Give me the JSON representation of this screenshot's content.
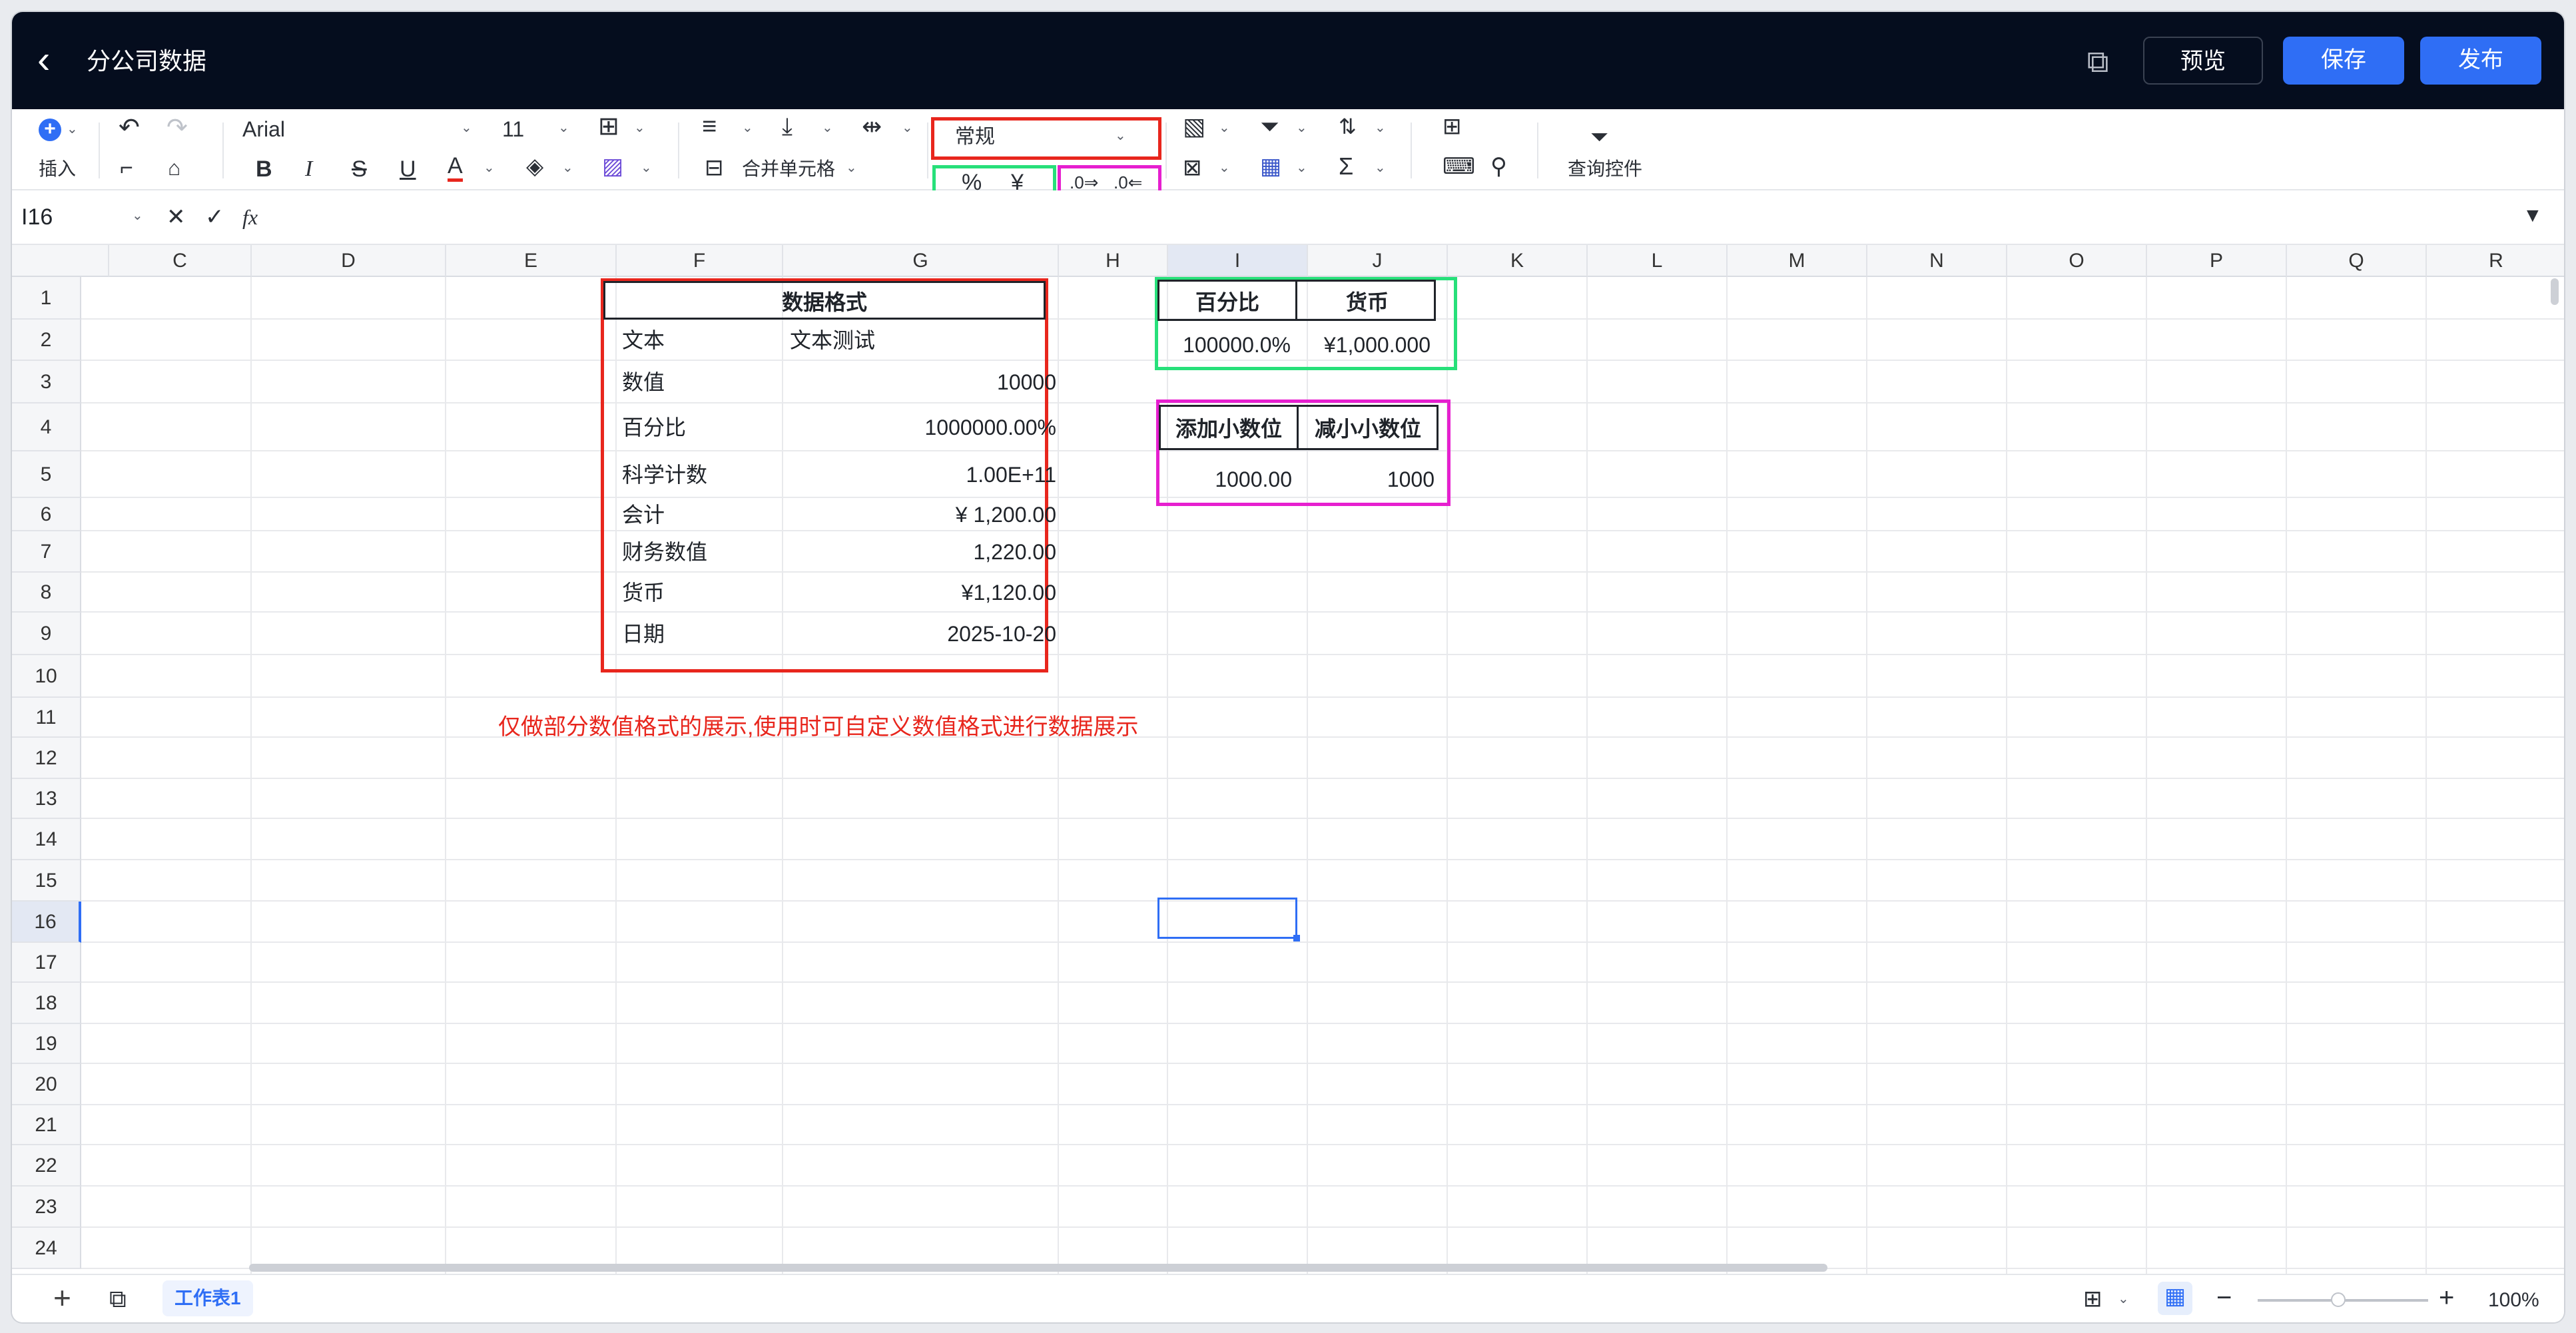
{
  "header": {
    "title": "分公司数据",
    "preview": "预览",
    "save": "保存",
    "publish": "发布"
  },
  "toolbar": {
    "insert": "插入",
    "font": "Arial",
    "font_size": "11",
    "merge": "合并单元格",
    "number_format": "常规",
    "query": "查询控件"
  },
  "formula_bar": {
    "cell_ref": "I16",
    "fx": "fx"
  },
  "columns": [
    "C",
    "D",
    "E",
    "F",
    "G",
    "H",
    "I",
    "J",
    "K",
    "L",
    "M",
    "N",
    "O",
    "P",
    "Q",
    "R"
  ],
  "rows": [
    "1",
    "2",
    "3",
    "4",
    "5",
    "6",
    "7",
    "8",
    "9",
    "10",
    "11",
    "12",
    "13",
    "14",
    "15",
    "16",
    "17",
    "18",
    "19",
    "20",
    "21",
    "22",
    "23",
    "24"
  ],
  "table_main": {
    "title": "数据格式",
    "rows": [
      {
        "label": "文本",
        "value": "文本测试"
      },
      {
        "label": "数值",
        "value": "10000"
      },
      {
        "label": "百分比",
        "value": "1000000.00%"
      },
      {
        "label": "科学计数",
        "value": "1.00E+11"
      },
      {
        "label": "会计",
        "value": "¥ 1,200.00"
      },
      {
        "label": "财务数值",
        "value": "1,220.00"
      },
      {
        "label": "货币",
        "value": "¥1,120.00"
      },
      {
        "label": "日期",
        "value": "2025-10-20"
      }
    ]
  },
  "table_percent": {
    "h1": "百分比",
    "h2": "货币",
    "v1": "100000.0%",
    "v2": "¥1,000.000"
  },
  "table_decimal": {
    "h1": "添加小数位",
    "h2": "减小小数位",
    "v1": "1000.00",
    "v2": "1000"
  },
  "note": "仅做部分数值格式的展示,使用时可自定义数值格式进行数据展示",
  "sheets": [
    {
      "label": "工作表1"
    }
  ],
  "zoom": "100%",
  "colors": {
    "header_bg": "#050d1e",
    "accent": "#2f6ef5",
    "red": "#e8261d",
    "green": "#27e07a",
    "magenta": "#e61fcf"
  }
}
